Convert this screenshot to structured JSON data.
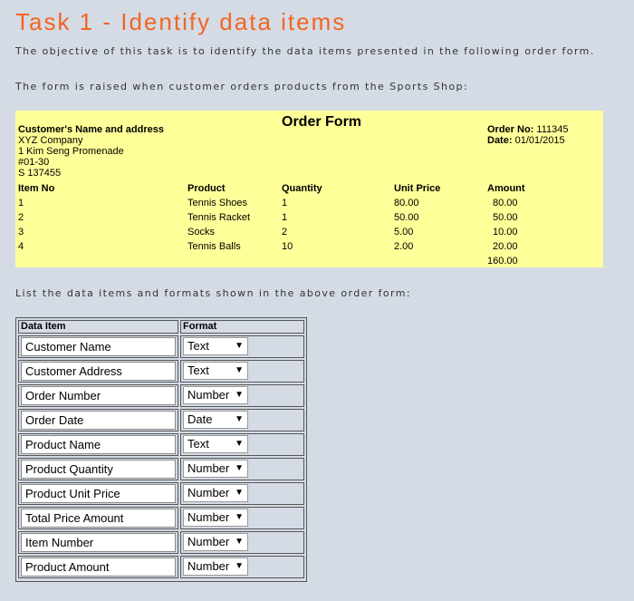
{
  "title": "Task 1 - Identify data items",
  "intro": "The objective of this task is to identify the data items presented in the following order form.",
  "form_raised": "The form is raised when customer orders products from the Sports Shop:",
  "order_form": {
    "title": "Order Form",
    "customer_label": "Customer's Name and address",
    "address_lines": [
      "XYZ Company",
      "1 Kim Seng Promenade",
      "#01-30",
      "S 137455"
    ],
    "order_no_label": "Order No:",
    "order_no": "111345",
    "date_label": "Date:",
    "date": "01/01/2015",
    "headers": [
      "Item No",
      "Product",
      "Quantity",
      "Unit Price",
      "Amount"
    ],
    "rows": [
      [
        "1",
        "Tennis Shoes",
        "1",
        "80.00",
        "80.00"
      ],
      [
        "2",
        "Tennis Racket",
        "1",
        "50.00",
        "50.00"
      ],
      [
        "3",
        "Socks",
        "2",
        "5.00",
        "10.00"
      ],
      [
        "4",
        "Tennis Balls",
        "10",
        "2.00",
        "20.00"
      ]
    ],
    "total": "160.00"
  },
  "list_prompt": "List the data items and formats shown in the above order form:",
  "task_table": {
    "headers": [
      "Data Item",
      "Format"
    ],
    "rows": [
      {
        "item": "Customer Name",
        "format": "Text"
      },
      {
        "item": "Customer Address",
        "format": "Text"
      },
      {
        "item": "Order Number",
        "format": "Number"
      },
      {
        "item": "Order Date",
        "format": "Date"
      },
      {
        "item": "Product Name",
        "format": "Text"
      },
      {
        "item": "Product Quantity",
        "format": "Number"
      },
      {
        "item": "Product Unit Price",
        "format": "Number"
      },
      {
        "item": "Total Price Amount",
        "format": "Number"
      },
      {
        "item": "Item Number",
        "format": "Number"
      },
      {
        "item": "Product Amount",
        "format": "Number"
      }
    ]
  }
}
